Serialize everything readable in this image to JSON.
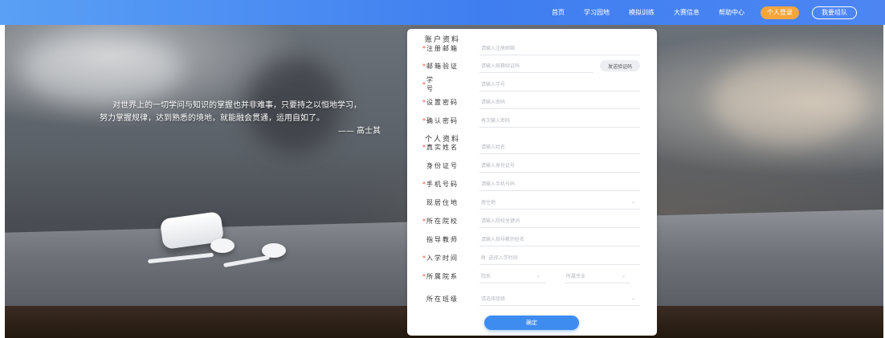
{
  "nav": {
    "items": [
      "首页",
      "学习园地",
      "模拟训练",
      "大赛信息",
      "帮助中心"
    ],
    "login_label": "个人登录",
    "team_label": "我要组队"
  },
  "quote": {
    "line1": "对世界上的一切学问与知识的掌握也并非难事，只要持之以恒地学习，",
    "line2": "努力掌握规律，达到熟悉的境地，就能融会贯通，运用自如了。",
    "author": "—— 高士其"
  },
  "form": {
    "account_title": "账户资料",
    "personal_title": "个人资料",
    "email_label": "注册邮箱",
    "email_placeholder": "请输入注册邮箱",
    "verify_label": "邮箱验证",
    "verify_placeholder": "请输入邮箱验证码",
    "send_code_label": "发送验证码",
    "student_id_label": "学号",
    "student_id_placeholder": "请输入学号",
    "password_label": "设置密码",
    "password_placeholder": "请输入密码",
    "confirm_label": "确认密码",
    "confirm_placeholder": "再次输入密码",
    "name_label": "真实姓名",
    "name_placeholder": "请输入姓名",
    "idcard_label": "身份证号",
    "idcard_placeholder": "请输入身份证号",
    "phone_label": "手机号码",
    "phone_placeholder": "请输入手机号码",
    "residence_label": "现居住地",
    "residence_placeholder": "居住地",
    "school_label": "所在院校",
    "school_placeholder": "请输入院校关键词",
    "teacher_label": "指导教师",
    "teacher_placeholder": "请输入指导教师姓名",
    "enroll_label": "入学时间",
    "enroll_placeholder": "选择入学时间",
    "dept_label": "所属院系",
    "college_placeholder": "院系",
    "major_placeholder": "所属专业",
    "class_label": "所在班级",
    "class_placeholder": "请选择班级",
    "submit_label": "确定",
    "required_mark": "*"
  },
  "colors": {
    "nav_gradient_start": "#5aa0f5",
    "nav_gradient_end": "#3f7ef0",
    "login_pill": "#f4a63c",
    "submit_button": "#3f8cf0",
    "required": "#e84b4b"
  },
  "icons": {
    "select_caret": "chevron-down-icon",
    "calendar": "calendar-icon"
  }
}
